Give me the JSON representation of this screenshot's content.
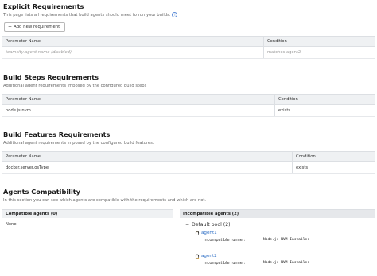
{
  "explicit": {
    "title": "Explicit Requirements",
    "description": "This page lists all requirements that build agents should meet to run your builds.",
    "add_button": "Add new requirement",
    "headers": [
      "Parameter Name",
      "Condition"
    ],
    "rows": [
      {
        "param": "teamcity.agent.name (disabled)",
        "condition": "matches agent2"
      }
    ]
  },
  "build_steps": {
    "title": "Build Steps Requirements",
    "description": "Additional agent requirements imposed by the configured build steps",
    "headers": [
      "Parameter Name",
      "Condition"
    ],
    "rows": [
      {
        "param": "node.js.nvm",
        "condition": "exists"
      }
    ]
  },
  "build_features": {
    "title": "Build Features Requirements",
    "description": "Additional agent requirements imposed by the configured build features.",
    "headers": [
      "Parameter Name",
      "Condition"
    ],
    "rows": [
      {
        "param": "docker.server.osType",
        "condition": "exists"
      }
    ]
  },
  "compatibility": {
    "title": "Agents Compatibility",
    "description": "In this section you can see which agents are compatible with the requirements and which are not.",
    "compatible_header": "Compatible agents (0)",
    "incompatible_header": "Incompatible agents (2)",
    "compatible_empty": "None",
    "pool": "Default pool (2)",
    "agents": [
      {
        "name": "agent1",
        "runner_label": "Incompatible runner:",
        "runner": "Node.js NVM Installer"
      },
      {
        "name": "agent2",
        "runner_label": "Incompatible runner:",
        "runner": "Node.js NVM Installer"
      }
    ]
  },
  "icons": {
    "info": "info-icon",
    "plus": "plus-icon",
    "collapse": "minus-icon",
    "agent_os": "linux-penguin-icon"
  }
}
